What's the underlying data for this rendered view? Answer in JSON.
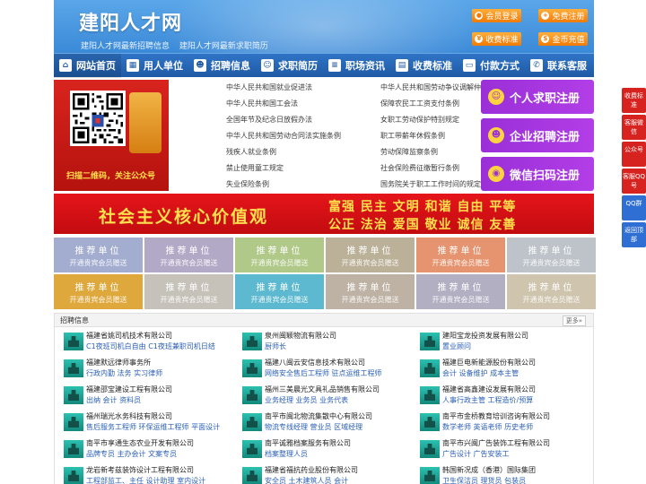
{
  "header": {
    "logo": "建阳人才网",
    "subtitle": [
      "建阳人才网最新招聘信息",
      "建阳人才网最新求职简历"
    ],
    "buttons": [
      "会员登录",
      "免费注册",
      "收费标准",
      "金币充值"
    ]
  },
  "nav": [
    "网站首页",
    "用人单位",
    "招聘信息",
    "求职简历",
    "职场资讯",
    "收费标准",
    "付款方式",
    "联系客服"
  ],
  "qr": {
    "caption": "扫描二维码，关注公众号"
  },
  "laws": {
    "left": [
      "中华人民共和国就业促进法",
      "中华人民共和国工会法",
      "全国年节及纪念日放假办法",
      "中华人民共和国劳动合同法实施条例",
      "残疾人就业条例",
      "禁止使用童工规定",
      "失业保险条例"
    ],
    "right": [
      "中华人民共和国劳动争议调解仲裁法",
      "保障农民工工资支付条例",
      "女职工劳动保护特别规定",
      "职工带薪年休假条例",
      "劳动保障监察条例",
      "社会保险费征缴暂行条例",
      "国务院关于职工工作时间的规定"
    ]
  },
  "register": [
    "个人求职注册",
    "企业招聘注册",
    "微信扫码注册"
  ],
  "banner": {
    "big": "社会主义核心价值观",
    "values1": "富强  民主  文明  和谐  自由  平等",
    "values2": "公正  法治  爱国  敬业  诚信  友善"
  },
  "recommend": {
    "title": "推荐单位",
    "sub": "开通贵宾会员赠送"
  },
  "jobs": {
    "title": "招聘信息",
    "more": "更多»",
    "items": [
      {
        "company": "福建省姚司机技术有限公司",
        "positions": "C1夜班司机白自由 C1夜班兼职司机日结"
      },
      {
        "company": "泉州闽颖物流有限公司",
        "positions": "厨师长"
      },
      {
        "company": "建阳宝龙投资发展有限公司",
        "positions": "置业顾问"
      },
      {
        "company": "福建默远律师事务所",
        "positions": "行政内勤 法务 实习律师"
      },
      {
        "company": "福建八闽云安信息技术有限公司",
        "positions": "网络安全售后工程师 驻点运维工程师"
      },
      {
        "company": "福建巨电新能源股份有限公司",
        "positions": "会计 设备维护 成本主管"
      },
      {
        "company": "福建邵宝建设工程有限公司",
        "positions": "出纳 会计 资料员"
      },
      {
        "company": "福州三美晨光文具礼品销售有限公司",
        "positions": "业务经理 业务员 业务代表"
      },
      {
        "company": "福建省高鑫建设发展有限公司",
        "positions": "人事行政主管 工程造价/预算"
      },
      {
        "company": "福州瑞光水务科技有限公司",
        "positions": "售后服务工程师 环保运维工程师 平面设计"
      },
      {
        "company": "南平市闽北物流集散中心有限公司",
        "positions": "物流专线经理 营业员 区域经理"
      },
      {
        "company": "南平市金桥教育培训咨询有限公司",
        "positions": "数学老师 英语老师 历史老师"
      },
      {
        "company": "南平市享通生态农业开发有限公司",
        "positions": "品牌专员 主办会计 文案专员"
      },
      {
        "company": "南平诚雅档案服务有限公司",
        "positions": "档案整理人员"
      },
      {
        "company": "南平市兴闽广告装饰工程有限公司",
        "positions": "广告设计 广告安装工"
      },
      {
        "company": "龙岩新考兹装饰设计工程有限公司",
        "positions": "工程部监工、主任 设计助理 室内设计"
      },
      {
        "company": "福建省福抗药业股份有限公司",
        "positions": "安全员 土木建筑人员 会计"
      },
      {
        "company": "韩国新况成（香港）国际集团",
        "positions": "卫生保洁员 理货员 包装员"
      }
    ]
  },
  "float": [
    "收费标准",
    "客服微信",
    "公众号",
    "客服QQ号",
    "QQ群",
    "返回顶部"
  ],
  "colors": {
    "nav": "#1f5aa5",
    "accent": "#f27a05",
    "banner": "#d7231f",
    "register": "#a837de"
  }
}
